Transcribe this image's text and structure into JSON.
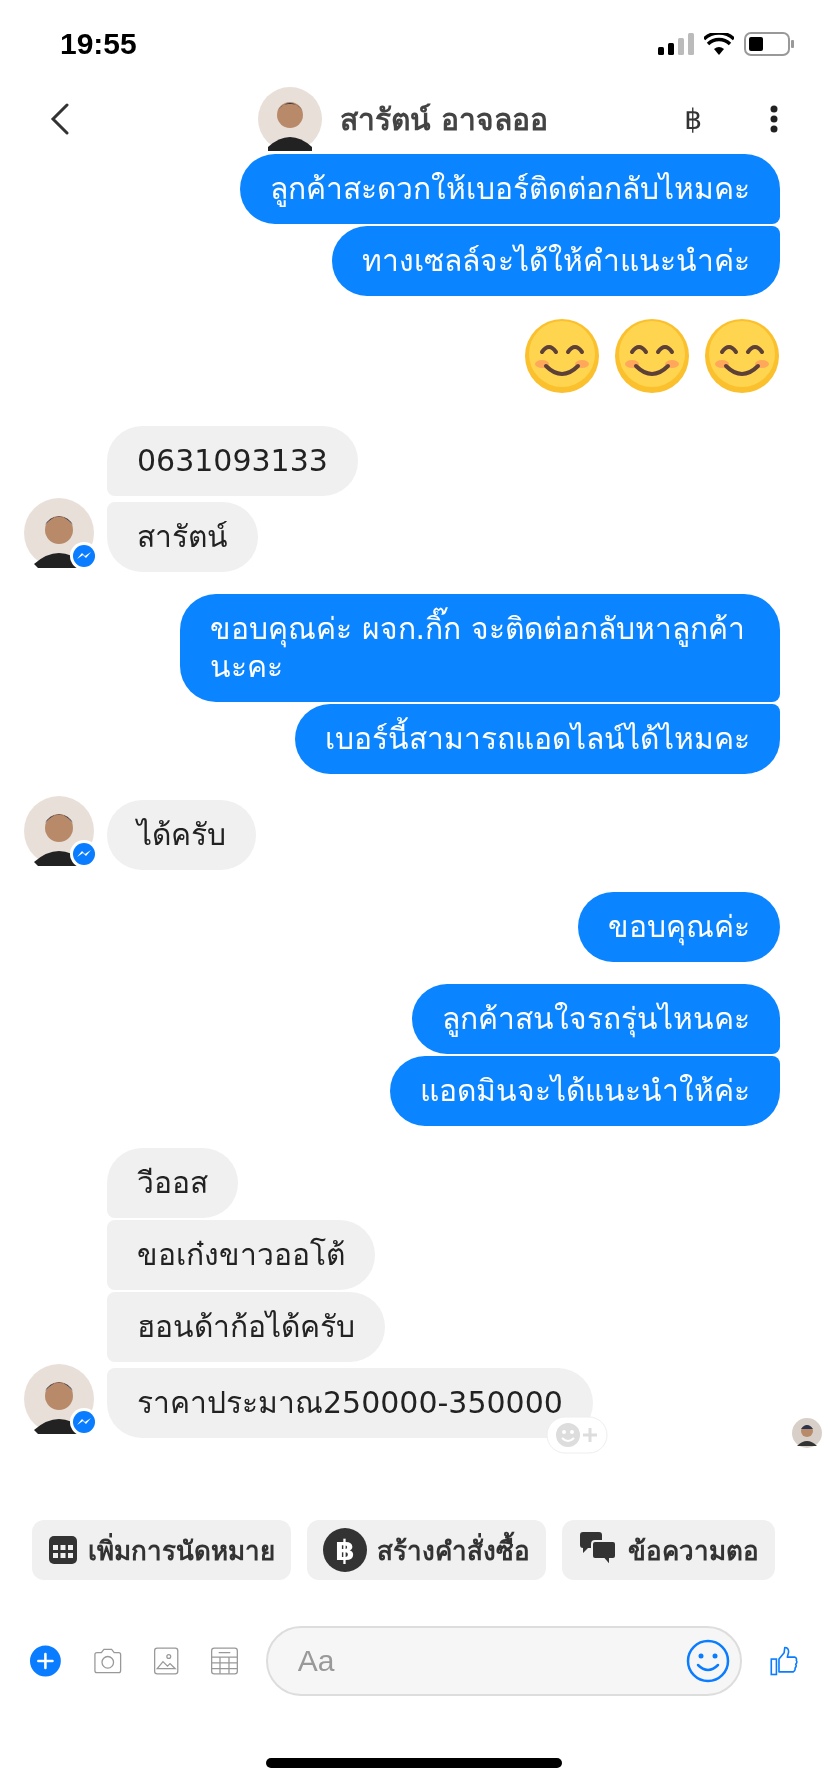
{
  "status_bar": {
    "time": "19:55"
  },
  "header": {
    "name": "สารัตน์ อาจลออ",
    "currency_icon": "฿"
  },
  "groups": [
    {
      "kind": "outgoing",
      "items": [
        {
          "kind": "text",
          "text": "ลูกค้าสะดวกให้เบอร์ติดต่อกลับไหมคะ"
        },
        {
          "kind": "text",
          "text": "ทางเซลล์จะได้ให้คำแนะนำค่ะ"
        }
      ]
    },
    {
      "kind": "outgoing",
      "items": [
        {
          "kind": "emoji_row",
          "count_items": [
            {
              "kind": "smiley"
            },
            {
              "kind": "smiley"
            },
            {
              "kind": "smiley"
            }
          ]
        }
      ]
    },
    {
      "kind": "incoming",
      "items": [
        {
          "kind": "text",
          "text": "0631093133"
        },
        {
          "kind": "text",
          "text": "สารัตน์"
        }
      ]
    },
    {
      "kind": "outgoing",
      "items": [
        {
          "kind": "text",
          "text": "ขอบคุณค่ะ ผจก.กิ๊ก จะติดต่อกลับหาลูกค้านะคะ"
        },
        {
          "kind": "text",
          "text": "เบอร์นี้สามารถแอดไลน์ได้ไหมคะ"
        }
      ]
    },
    {
      "kind": "incoming",
      "items": [
        {
          "kind": "text",
          "text": "ได้ครับ"
        }
      ]
    },
    {
      "kind": "outgoing",
      "items": [
        {
          "kind": "text",
          "text": "ขอบคุณค่ะ"
        }
      ]
    },
    {
      "kind": "outgoing",
      "items": [
        {
          "kind": "text",
          "text": "ลูกค้าสนใจรถรุ่นไหนคะ"
        },
        {
          "kind": "text",
          "text": "แอดมินจะได้แนะนำให้ค่ะ"
        }
      ]
    },
    {
      "kind": "incoming",
      "read": true,
      "items": [
        {
          "kind": "text",
          "text": "วีออส"
        },
        {
          "kind": "text",
          "text": "ขอเก๋งขาวออโต้"
        },
        {
          "kind": "text",
          "text": "ฮอนด้าก้อได้ครับ"
        },
        {
          "kind": "text",
          "text": "ราคาประมาณ250000-350000"
        }
      ]
    }
  ],
  "quick_replies": [
    {
      "kind": "calendar",
      "label": "เพิ่มการนัดหมาย"
    },
    {
      "kind": "currency",
      "icon": "฿",
      "label": "สร้างคำสั่งซื้อ"
    },
    {
      "kind": "chat",
      "label": "ข้อความตอ"
    }
  ],
  "composer": {
    "placeholder": "Aa"
  }
}
